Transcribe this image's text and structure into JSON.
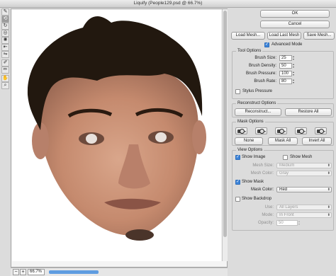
{
  "window": {
    "title": "Liquify (People129.psd @ 66.7%)"
  },
  "tools": [
    {
      "name": "forward-warp-icon",
      "glyph": "✎",
      "active": false
    },
    {
      "name": "reconstruct-icon",
      "glyph": "⟲",
      "active": true
    },
    {
      "name": "twirl-icon",
      "glyph": "↻",
      "active": false
    },
    {
      "name": "pucker-icon",
      "glyph": "◎",
      "active": false
    },
    {
      "name": "bloat-icon",
      "glyph": "✺",
      "active": false
    },
    {
      "name": "push-left-icon",
      "glyph": "⇤",
      "active": false
    },
    {
      "name": "mirror-icon",
      "glyph": "⇋",
      "active": false
    },
    {
      "name": "freeze-mask-icon",
      "glyph": "✐",
      "active": false
    },
    {
      "name": "thaw-mask-icon",
      "glyph": "✏",
      "active": false
    },
    {
      "name": "hand-icon",
      "glyph": "✋",
      "active": false
    },
    {
      "name": "zoom-icon",
      "glyph": "⌕",
      "active": false
    }
  ],
  "status": {
    "minus": "−",
    "plus": "+",
    "zoom": "66.7%"
  },
  "panel": {
    "ok": "OK",
    "cancel": "Cancel",
    "load_mesh": "Load Mesh...",
    "load_last_mesh": "Load Last Mesh",
    "save_mesh": "Save Mesh...",
    "advanced_mode": "Advanced Mode",
    "tool_options": {
      "title": "Tool Options",
      "brush_size_label": "Brush Size:",
      "brush_size": "25",
      "brush_density_label": "Brush Density:",
      "brush_density": "50",
      "brush_pressure_label": "Brush Pressure:",
      "brush_pressure": "100",
      "brush_rate_label": "Brush Rate:",
      "brush_rate": "80",
      "stylus_pressure": "Stylus Pressure"
    },
    "reconstruct_options": {
      "title": "Reconstruct Options",
      "reconstruct": "Reconstruct...",
      "restore_all": "Restore All"
    },
    "mask_options": {
      "title": "Mask Options",
      "none": "None",
      "mask_all": "Mask All",
      "invert_all": "Invert All"
    },
    "view_options": {
      "title": "View Options",
      "show_image": "Show Image",
      "show_mesh": "Show Mesh",
      "mesh_size_label": "Mesh Size:",
      "mesh_size": "Medium",
      "mesh_color_label": "Mesh Color:",
      "mesh_color": "Gray",
      "show_mask": "Show Mask",
      "mask_color_label": "Mask Color:",
      "mask_color": "Red",
      "show_backdrop": "Show Backdrop",
      "use_label": "Use:",
      "use": "All Layers",
      "mode_label": "Mode:",
      "mode": "In Front",
      "opacity_label": "Opacity:",
      "opacity": "50"
    }
  },
  "colors": {
    "accent": "#3d84d8",
    "scroll_blue": "#5f9ce0"
  }
}
